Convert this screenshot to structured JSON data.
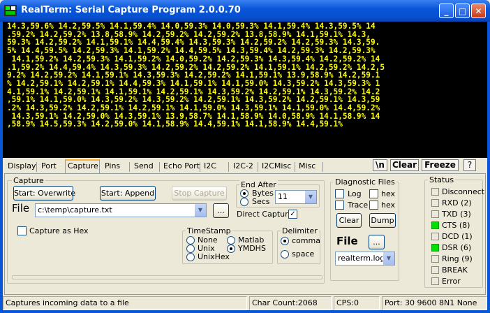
{
  "window": {
    "title": "RealTerm: Serial Capture Program 2.0.0.70",
    "minimize": "_",
    "maximize": "□",
    "close": "✕"
  },
  "terminal": {
    "lines": [
      "14.3,59.6% 14.2,59.5% 14.1,59.4% 14.0,59.3% 14.0,59.3% 14.1,59.4% 14.3,59.5% 14",
      ".59.2% 14.2,59.2% 13.8,58.9% 14.2,59.2% 14.2,59.2% 13.8,58.9% 14.1,59.1% 14.3,",
      "59.3% 14.2,59.2% 14.1,59.1% 14.4,59.4% 14.3,59.3% 14.2,59.2% 14.2,59.3% 14.3,59.",
      "5% 14.4,59.5% 14.2,59.3% 14.1,59.2% 14.4,59.5% 14.3,59.4% 14.2,59.3% 14.2,59.3%",
      " 14.1,59.2% 14.2,59.3% 14.1,59.2% 14.0,59.2% 14.2,59.3% 14.3,59.4% 14.2,59.2% 14",
      ".1,59.2% 14.4,59.4% 14.3,59.3% 14.2,59.2% 14.2,59.2% 14.1,59.1% 14.2,59.2% 14.2,5",
      "9.2% 14.2,59.2% 14.1,59.1% 14.3,59.3% 14.2,59.2% 14.1,59.1% 13.9,58.9% 14.2,59.1",
      "% 14.2,59.1% 14.2,59.1% 14.4,59.3% 14.1,59.1% 14.1,59.0% 14.3,59.2% 14.3,59.3% 1",
      "4.1,59.1% 14.2,59.1% 14.1,59.1% 14.2,59.1% 14.3,59.2% 14.2,59.1% 14.3,59.2% 14.2",
      ",59.1% 14.1,59.0% 14.3,59.2% 14.3,59.2% 14.2,59.1% 14.3,59.2% 14.2,59.1% 14.3,59",
      ".2% 14.3,59.2% 14.2,59.1% 14.2,59.1% 14.1,59.0% 14.3,59.1% 14.1,59.0% 14.4,59.2%",
      " 14.3,59.1% 14.2,59.0% 14.3,59.1% 13.9,58.7% 14.1,58.9% 14.0,58.9% 14.1,58.9% 14",
      ",58.9% 14.5,59.3% 14.2,59.0% 14.1,58.9% 14.4,59.1% 14.1,58.9% 14.4,59.1%"
    ]
  },
  "tabs": [
    {
      "label": "Display",
      "active": false
    },
    {
      "label": "Port",
      "active": false
    },
    {
      "label": "Capture",
      "active": true
    },
    {
      "label": "Pins",
      "active": false
    },
    {
      "label": "Send",
      "active": false
    },
    {
      "label": "Echo Port",
      "active": false
    },
    {
      "label": "I2C",
      "active": false
    },
    {
      "label": "I2C-2",
      "active": false
    },
    {
      "label": "I2CMisc",
      "active": false
    },
    {
      "label": "Misc",
      "active": false
    }
  ],
  "toolbar": {
    "newline_label": "\\n",
    "clear_label": "Clear",
    "freeze_label": "Freeze",
    "help_label": "?"
  },
  "capture": {
    "group_label": "Capture",
    "start_overwrite": "Start: Overwrite",
    "start_append": "Start: Append",
    "stop_capture": "Stop Capture",
    "file_label": "File",
    "file_path": "c:\\temp\\capture.txt",
    "browse_label": "...",
    "capture_as_hex": "Capture as Hex",
    "end_after_label": "End After",
    "bytes_label": "Bytes",
    "secs_label": "Secs",
    "end_after_value": "11",
    "direct_capture": "Direct Capture",
    "timestamp_label": "TimeStamp",
    "ts_none": "None",
    "ts_unix": "Unix",
    "ts_unixhex": "UnixHex",
    "ts_matlab": "Matlab",
    "ts_ymdhs": "YMDHS",
    "delimiter_label": "Delimiter",
    "delim_comma": "comma",
    "delim_space": "space"
  },
  "diagnostic": {
    "group_label": "Diagnostic Files",
    "log_label": "Log",
    "trace_label": "Trace",
    "hex1_label": "hex",
    "hex2_label": "hex",
    "clear_label": "Clear",
    "dump_label": "Dump",
    "file_label": "File",
    "browse_label": "...",
    "file_value": "realterm.log"
  },
  "status": {
    "group_label": "Status",
    "items": [
      {
        "label": "Disconnect",
        "on": false
      },
      {
        "label": "RXD (2)",
        "on": false
      },
      {
        "label": "TXD (3)",
        "on": false
      },
      {
        "label": "CTS (8)",
        "on": true
      },
      {
        "label": "DCD (1)",
        "on": false
      },
      {
        "label": "DSR (6)",
        "on": true
      },
      {
        "label": "Ring (9)",
        "on": false
      },
      {
        "label": "BREAK",
        "on": false
      },
      {
        "label": "Error",
        "on": false
      }
    ]
  },
  "statusbar": {
    "message": "Captures incoming data to a file",
    "char_count": "Char Count:2068",
    "cps": "CPS:0",
    "port": "Port: 30 9600 8N1 None"
  },
  "colors": {
    "terminal_fg": "#ffff00",
    "terminal_bg": "#000000",
    "led_on": "#00e000",
    "titlebar": "#0a56d8"
  }
}
